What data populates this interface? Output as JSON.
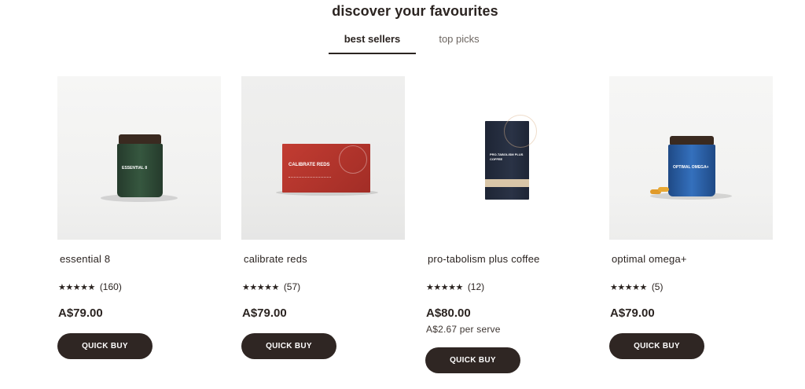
{
  "heading": "discover your favourites",
  "tabs": [
    {
      "label": "best sellers",
      "active": true
    },
    {
      "label": "top picks",
      "active": false
    }
  ],
  "products": [
    {
      "name": "essential 8",
      "rating": 5,
      "stars": "★★★★★",
      "reviews": "(160)",
      "price": "A$79.00",
      "per_serve": "",
      "button": "QUICK BUY",
      "pack_text": "ESSENTIAL 8"
    },
    {
      "name": "calibrate reds",
      "rating": 5,
      "stars": "★★★★★",
      "reviews": "(57)",
      "price": "A$79.00",
      "per_serve": "",
      "button": "QUICK BUY",
      "pack_text": "CALIBRATE REDS"
    },
    {
      "name": "pro-tabolism plus coffee",
      "rating": 5,
      "stars": "★★★★★",
      "reviews": "(12)",
      "price": "A$80.00",
      "per_serve": "A$2.67 per serve",
      "button": "QUICK BUY",
      "pack_text": "PRO-TABOLISM PLUS COFFEE"
    },
    {
      "name": "optimal omega+",
      "rating": 5,
      "stars": "★★★★★",
      "reviews": "(5)",
      "price": "A$79.00",
      "per_serve": "",
      "button": "QUICK BUY",
      "pack_text": "OPTIMAL OMEGA+"
    }
  ],
  "colors": {
    "text": "#2b2421",
    "button_bg": "#2f2623",
    "essential8_jar": "#2f4a37",
    "calibrate_box": "#b2352d",
    "protabolism_box": "#22293a",
    "omega_jar": "#2b5da1"
  }
}
